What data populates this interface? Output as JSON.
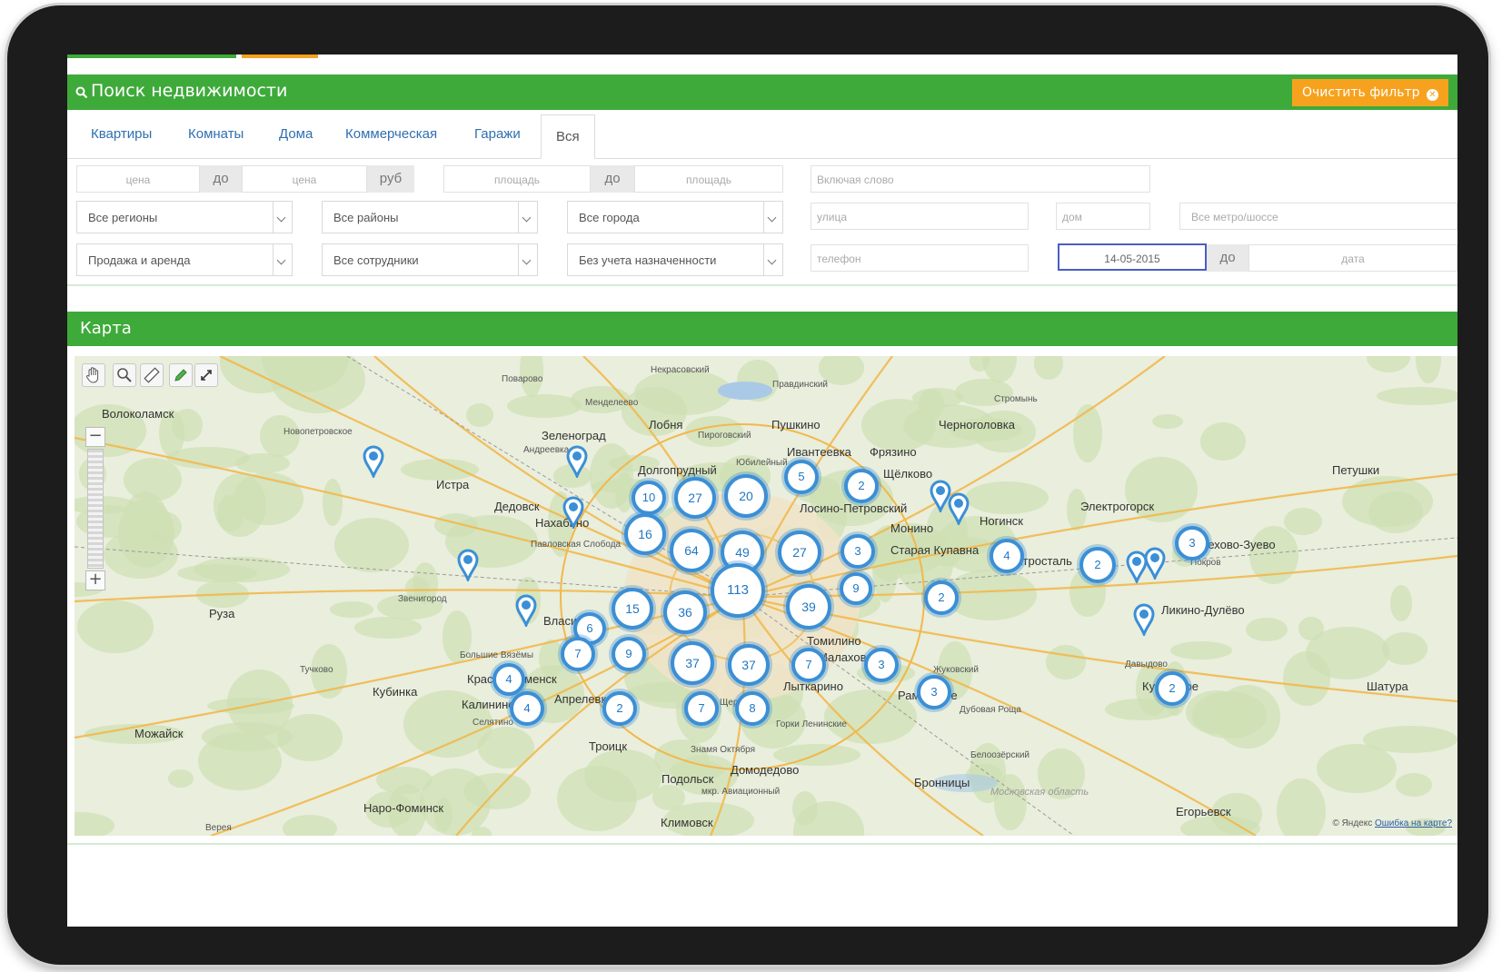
{
  "search": {
    "title": "Поиск недвижимости",
    "clear_button": "Очистить фильтр"
  },
  "tabs": [
    {
      "label": "Квартиры"
    },
    {
      "label": "Комнаты"
    },
    {
      "label": "Дома"
    },
    {
      "label": "Коммерческая"
    },
    {
      "label": "Гаражи"
    },
    {
      "label": "Вся",
      "active": true
    }
  ],
  "filters": {
    "price_from": "цена",
    "price_to_sep": "до",
    "price_to": "цена",
    "price_currency": "руб",
    "area_from": "площадь",
    "area_to_sep": "до",
    "area_to": "площадь",
    "keyword": "Включая слово",
    "region": "Все регионы",
    "district": "Все районы",
    "city": "Все города",
    "street": "улица",
    "house": "дом",
    "metro": "Все метро/шоссе",
    "deal_type": "Продажа и аренда",
    "employee": "Все сотрудники",
    "assignment": "Без учета назначенности",
    "phone": "телефон",
    "date_from": "14-05-2015",
    "date_to_sep": "до",
    "date_to": "дата"
  },
  "map": {
    "title": "Карта",
    "footer_brand": "© Яндекс",
    "footer_link": "Ошибка на карте?",
    "clusters": [
      "10",
      "27",
      "20",
      "5",
      "2",
      "16",
      "64",
      "49",
      "27",
      "3",
      "113",
      "9",
      "15",
      "36",
      "39",
      "2",
      "4",
      "2",
      "3",
      "6",
      "7",
      "9",
      "37",
      "37",
      "7",
      "3",
      "3",
      "4",
      "4",
      "2",
      "7",
      "8",
      "2"
    ],
    "places": [
      "Волоколамск",
      "Новопетровское",
      "Истра",
      "Зеленоград",
      "Андреевка",
      "Лобня",
      "Пироговский",
      "Пушкино",
      "Ивантеевка",
      "Фрязино",
      "Щёлково",
      "Черноголовка",
      "Стромынь",
      "Долгопрудный",
      "Юбилейный",
      "Дедовск",
      "Нахабино",
      "Павловская Слобода",
      "Лосино-Петровский",
      "Монино",
      "Ногинск",
      "Электрогорск",
      "Электросталь",
      "Старая Купавна",
      "Орехово-Зуево",
      "Ликино-Дулёво",
      "Покров",
      "Петушки",
      "Звенигород",
      "Руза",
      "Кубинка",
      "Можайск",
      "Власиха",
      "Большие Вязёмы",
      "Краснознаменск",
      "Калининец",
      "Апрелевка",
      "Троицк",
      "Подольск",
      "Домодедово",
      "Климовск",
      "Наро-Фоминск",
      "Бронницы",
      "Раменское",
      "Лыткарино",
      "Жуковский",
      "Томилино",
      "Малаховка",
      "Егорьевск",
      "Давыдово",
      "Куровское",
      "Шатура",
      "Дубовая Роща",
      "Белоозёрский",
      "Щербинка",
      "Московская область",
      "Верея",
      "Селятино",
      "Знамя Октября",
      "мкр. Авиационный",
      "Горки Ленинские",
      "Некрасовский",
      "Правдинский",
      "Менделеево",
      "Поварово",
      "Тучково"
    ]
  },
  "colors": {
    "header_green": "#3eaa3a",
    "clear_orange": "#f7a21e",
    "tab_blue": "#2f6faf",
    "cluster_blue": "#3b8fd6"
  }
}
